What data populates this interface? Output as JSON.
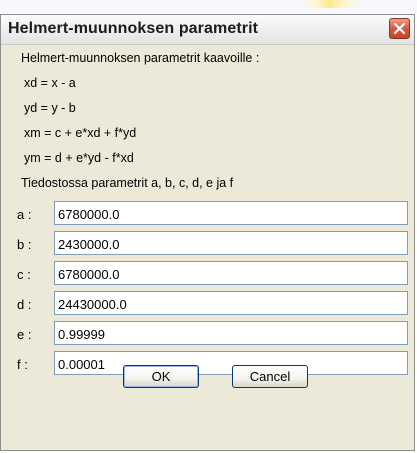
{
  "window": {
    "title": "Helmert-muunnoksen parametrit",
    "close_icon": "close-icon"
  },
  "info_lines": [
    "Helmert-muunnoksen parametrit kaavoille :",
    "xd = x - a",
    "yd = y - b",
    "xm = c + e*xd + f*yd",
    "ym = d + e*yd - f*xd",
    "Tiedostossa parametrit a, b, c, d, e ja f"
  ],
  "fields": [
    {
      "label": "a :",
      "value": "6780000.0"
    },
    {
      "label": "b :",
      "value": "2430000.0"
    },
    {
      "label": "c :",
      "value": "6780000.0"
    },
    {
      "label": "d :",
      "value": "24430000.0"
    },
    {
      "label": "e :",
      "value": "0.99999"
    },
    {
      "label": "f :",
      "value": "0.00001"
    }
  ],
  "buttons": {
    "ok_label": "OK",
    "cancel_label": "Cancel"
  },
  "colors": {
    "dialog_background": "#ece9d8",
    "close_button": "#d65b3a",
    "input_border": "#7f9db9"
  }
}
